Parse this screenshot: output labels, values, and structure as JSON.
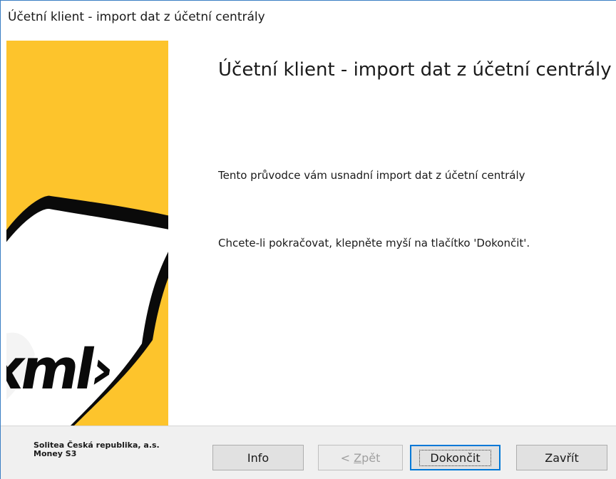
{
  "window": {
    "title": "Účetní klient - import dat z účetní centrály"
  },
  "sidebar": {
    "graphic_text": "‹xml›",
    "colors": {
      "yellow": "#fdc42c",
      "dark_yellow": "#e3ac12",
      "black": "#0a0a0a"
    }
  },
  "main": {
    "title": "Účetní klient - import dat z účetní centrály",
    "intro": "Tento průvodce vám usnadní import dat z účetní centrály",
    "instruction": "Chcete-li pokračovat, klepněte myší na tlačítko 'Dokončit'."
  },
  "footer": {
    "company_line1": "Solitea Česká republika, a.s.",
    "company_line2": "Money S3",
    "buttons": {
      "info": "Info",
      "back_prefix": "< ",
      "back_accel": "Z",
      "back_rest": "pět",
      "finish": "Dokončit",
      "close": "Zavřít"
    }
  }
}
